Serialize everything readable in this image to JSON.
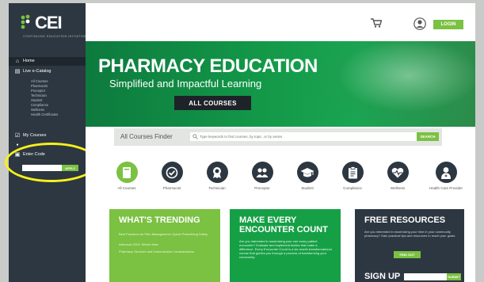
{
  "brand": {
    "logo_text": "CEI",
    "tagline": "CONTINUING EDUCATION INITIATIVE",
    "accent_color": "#7bc142",
    "sidebar_color": "#2d3741"
  },
  "sidebar": {
    "home": "Home",
    "live_catalog": "Live e-Catalog",
    "sub_items": [
      "All Courses",
      "Pharmacist",
      "Preceptor",
      "Technician",
      "Student",
      "Compliance",
      "Wellness",
      "Health Certificates"
    ],
    "my_courses": "My Courses",
    "enter_code_label": "Enter Code",
    "enter_code_placeholder": "",
    "enter_code_button": "APPLY"
  },
  "header": {
    "login_label": "LOGIN",
    "icons": [
      "cart-icon",
      "user-icon"
    ]
  },
  "hero": {
    "title": "PHARMACY EDUCATION",
    "subtitle": "Simplified and Impactful Learning",
    "button": "ALL COURSES"
  },
  "finder": {
    "label": "All Courses Finder",
    "placeholder": "Type keywords to find courses, by topic, or by series",
    "button": "SEARCH"
  },
  "categories": [
    {
      "label": "All Courses",
      "icon": "book-icon",
      "accent": true
    },
    {
      "label": "Pharmacist",
      "icon": "check-icon",
      "accent": false
    },
    {
      "label": "Technician",
      "icon": "ribbon-icon",
      "accent": false
    },
    {
      "label": "Preceptor",
      "icon": "people-icon",
      "accent": false
    },
    {
      "label": "Student",
      "icon": "graduation-cap-icon",
      "accent": false
    },
    {
      "label": "Compliance",
      "icon": "clipboard-icon",
      "accent": false
    },
    {
      "label": "Wellness",
      "icon": "heartbeat-icon",
      "accent": false
    },
    {
      "label": "Health Care Provider",
      "icon": "doctor-icon",
      "accent": false
    }
  ],
  "panels": {
    "trending": {
      "title": "WHAT'S TRENDING",
      "items": [
        "Best Practices for Pain Management: Opioid Prescribing Safely",
        "Influenza 2019: What's New",
        "Pharmacy Services and Immunization Considerations"
      ]
    },
    "encounter": {
      "title_line1": "MAKE EVERY",
      "title_line2": "ENCOUNTER COUNT",
      "body": "Are you interested in maximizing your role every patient encounter? Evaluate and implement tactics that make a difference. Every Encounter Count is a six-month transformational course that guides you through a process of transforming your community."
    },
    "free_resources": {
      "title": "FREE RESOURCES",
      "body": "Are you interested in maximizing your time in your community pharmacy? Gain practical tips and resources to reach your goals.",
      "button": "FIND OUT",
      "signup_title": "SIGN UP",
      "signup_button": "SUBMIT"
    }
  }
}
